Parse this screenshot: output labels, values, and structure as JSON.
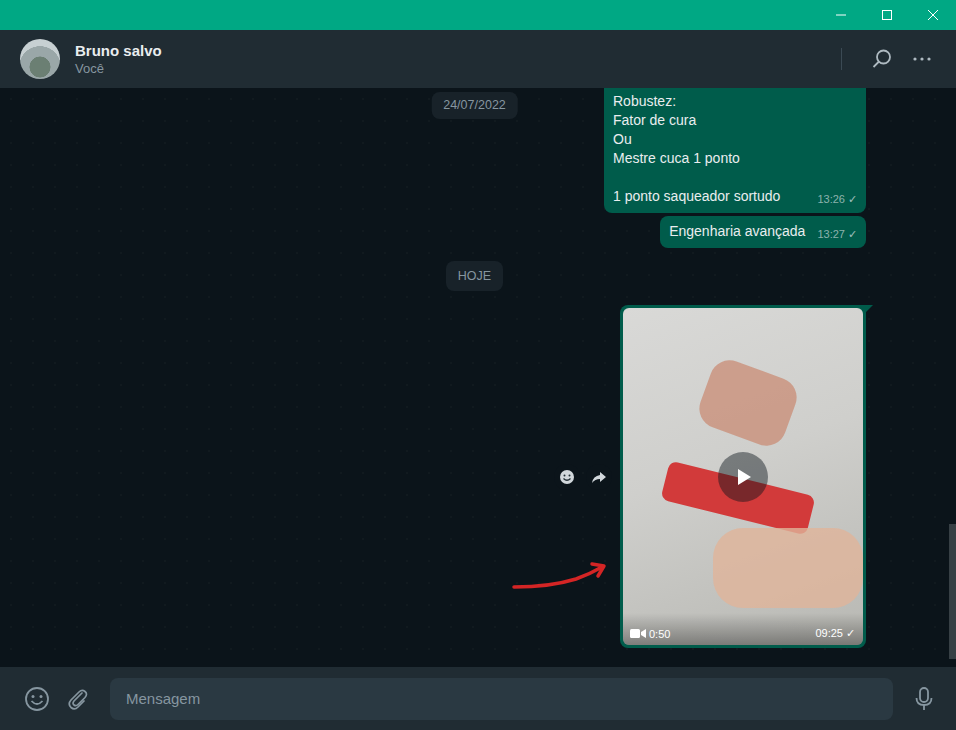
{
  "header": {
    "name": "Bruno salvo",
    "status": "Você"
  },
  "sticky_date": "24/07/2022",
  "messages": [
    {
      "kind": "text",
      "text": "Robustez:\nFator de cura\nOu\nMestre cuca 1 ponto\n\n1 ponto saqueador sortudo",
      "time": "13:26",
      "tick": "✓",
      "hovered": false
    },
    {
      "kind": "text",
      "text": "Engenharia avançada",
      "time": "13:27",
      "tick": "✓",
      "hovered": false
    },
    {
      "kind": "date",
      "label": "HOJE",
      "time": "",
      "tick": "",
      "hovered": false
    },
    {
      "kind": "video",
      "duration": "0:50",
      "time": "09:25",
      "tick": "✓",
      "hovered": true
    }
  ],
  "composer": {
    "placeholder": "Mensagem"
  }
}
